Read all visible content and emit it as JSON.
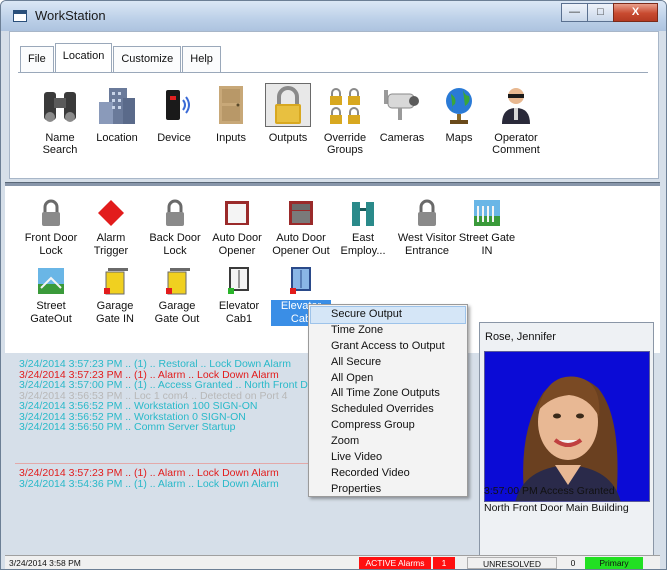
{
  "window": {
    "title": "WorkStation",
    "minimize_glyph": "—",
    "maximize_glyph": "□",
    "close_glyph": "X"
  },
  "menu_tabs": [
    {
      "label": "File"
    },
    {
      "label": "Location"
    },
    {
      "label": "Customize"
    },
    {
      "label": "Help"
    }
  ],
  "toolbar": [
    {
      "label": "Name Search",
      "icon": "binoculars-icon"
    },
    {
      "label": "Location",
      "icon": "building-icon"
    },
    {
      "label": "Device",
      "icon": "card-reader-icon"
    },
    {
      "label": "Inputs",
      "icon": "door-icon"
    },
    {
      "label": "Outputs",
      "icon": "padlock-icon"
    },
    {
      "label": "Override Groups",
      "icon": "padlock-group-icon"
    },
    {
      "label": "Cameras",
      "icon": "camera-icon"
    },
    {
      "label": "Maps",
      "icon": "globe-icon"
    },
    {
      "label": "Operator Comment",
      "icon": "operator-icon"
    }
  ],
  "devices": [
    {
      "label": "Front Door Lock",
      "icon": "padlock-icon"
    },
    {
      "label": "Alarm Trigger",
      "icon": "alarm-diamond-icon"
    },
    {
      "label": "Back Door Lock",
      "icon": "padlock-icon"
    },
    {
      "label": "Auto Door Opener",
      "icon": "auto-door-icon"
    },
    {
      "label": "Auto Door Opener Out",
      "icon": "auto-door-icon"
    },
    {
      "label": "East Employ...",
      "icon": "turnstile-icon"
    },
    {
      "label": "West Visitor Entrance",
      "icon": "padlock-icon"
    },
    {
      "label": "Street Gate IN",
      "icon": "gate-icon"
    },
    {
      "label": "Street GateOut",
      "icon": "gate-icon"
    },
    {
      "label": "Garage Gate IN",
      "icon": "garage-gate-icon"
    },
    {
      "label": "Garage Gate Out",
      "icon": "garage-gate-icon"
    },
    {
      "label": "Elevator Cab1",
      "icon": "elevator-icon"
    },
    {
      "label": "Elevator Cab",
      "icon": "elevator-icon"
    }
  ],
  "events": [
    {
      "text": "3/24/2014 3:57:23 PM .. (1) .. Restoral .. Lock Down Alarm",
      "color": "#29b9c9"
    },
    {
      "text": "3/24/2014 3:57:23 PM .. (1) .. Alarm .. Lock Down Alarm",
      "color": "#e21c1c"
    },
    {
      "text": "3/24/2014 3:57:00 PM .. (1) .. Access Granted .. North Front Door",
      "color": "#29b9c9"
    },
    {
      "text": "3/24/2014 3:56:53 PM .. Loc 1 com4 .. Detected on Port 4",
      "color": "#b8b8b8"
    },
    {
      "text": "3/24/2014 3:56:52 PM .. Workstation 100 SIGN-ON",
      "color": "#29b9c9"
    },
    {
      "text": "3/24/2014 3:56:52 PM .. Workstation 0 SIGN-ON",
      "color": "#29b9c9"
    },
    {
      "text": "3/24/2014 3:56:50 PM .. Comm Server Startup",
      "color": "#29b9c9"
    }
  ],
  "alarms": [
    {
      "text": "3/24/2014 3:57:23 PM .. (1) .. Alarm .. Lock Down Alarm",
      "color": "#e21c1c"
    },
    {
      "text": "3/24/2014 3:54:36 PM .. (1) .. Alarm .. Lock Down Alarm",
      "color": "#29b9c9"
    }
  ],
  "context_menu": [
    {
      "label": "Secure Output"
    },
    {
      "label": "Time Zone"
    },
    {
      "label": "Grant Access to Output"
    },
    {
      "label": "All Secure"
    },
    {
      "label": "All Open"
    },
    {
      "label": "All Time Zone Outputs"
    },
    {
      "label": "Scheduled Overrides"
    },
    {
      "label": "Compress Group"
    },
    {
      "label": "Zoom"
    },
    {
      "label": "Live Video"
    },
    {
      "label": "Recorded Video"
    },
    {
      "label": "Properties"
    }
  ],
  "person": {
    "name": "Rose, Jennifer",
    "event": "3:57:00 PM  Access Granted",
    "location": "North Front Door  Main Building"
  },
  "status": {
    "datetime": "3/24/2014 3:58 PM",
    "active_alarms_label": "ACTIVE Alarms",
    "active_alarms_count": "1",
    "unresolved_label": "UNRESOLVED Alarms",
    "unresolved_count": "0",
    "online_label": "Primary OnLine"
  },
  "colors": {
    "event_cyan": "#29b9c9",
    "event_red": "#e21c1c",
    "alarm_red": "#ff1010",
    "online_green": "#22e022",
    "photo_bg": "#0b0bd6"
  }
}
